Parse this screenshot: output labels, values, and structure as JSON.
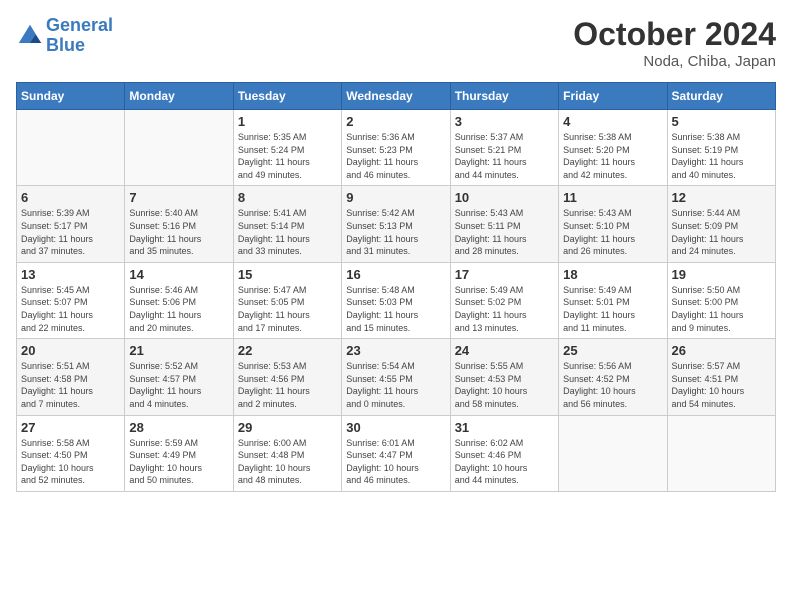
{
  "logo": {
    "line1": "General",
    "line2": "Blue"
  },
  "title": "October 2024",
  "subtitle": "Noda, Chiba, Japan",
  "days_of_week": [
    "Sunday",
    "Monday",
    "Tuesday",
    "Wednesday",
    "Thursday",
    "Friday",
    "Saturday"
  ],
  "weeks": [
    [
      {
        "day": "",
        "info": ""
      },
      {
        "day": "",
        "info": ""
      },
      {
        "day": "1",
        "info": "Sunrise: 5:35 AM\nSunset: 5:24 PM\nDaylight: 11 hours\nand 49 minutes."
      },
      {
        "day": "2",
        "info": "Sunrise: 5:36 AM\nSunset: 5:23 PM\nDaylight: 11 hours\nand 46 minutes."
      },
      {
        "day": "3",
        "info": "Sunrise: 5:37 AM\nSunset: 5:21 PM\nDaylight: 11 hours\nand 44 minutes."
      },
      {
        "day": "4",
        "info": "Sunrise: 5:38 AM\nSunset: 5:20 PM\nDaylight: 11 hours\nand 42 minutes."
      },
      {
        "day": "5",
        "info": "Sunrise: 5:38 AM\nSunset: 5:19 PM\nDaylight: 11 hours\nand 40 minutes."
      }
    ],
    [
      {
        "day": "6",
        "info": "Sunrise: 5:39 AM\nSunset: 5:17 PM\nDaylight: 11 hours\nand 37 minutes."
      },
      {
        "day": "7",
        "info": "Sunrise: 5:40 AM\nSunset: 5:16 PM\nDaylight: 11 hours\nand 35 minutes."
      },
      {
        "day": "8",
        "info": "Sunrise: 5:41 AM\nSunset: 5:14 PM\nDaylight: 11 hours\nand 33 minutes."
      },
      {
        "day": "9",
        "info": "Sunrise: 5:42 AM\nSunset: 5:13 PM\nDaylight: 11 hours\nand 31 minutes."
      },
      {
        "day": "10",
        "info": "Sunrise: 5:43 AM\nSunset: 5:11 PM\nDaylight: 11 hours\nand 28 minutes."
      },
      {
        "day": "11",
        "info": "Sunrise: 5:43 AM\nSunset: 5:10 PM\nDaylight: 11 hours\nand 26 minutes."
      },
      {
        "day": "12",
        "info": "Sunrise: 5:44 AM\nSunset: 5:09 PM\nDaylight: 11 hours\nand 24 minutes."
      }
    ],
    [
      {
        "day": "13",
        "info": "Sunrise: 5:45 AM\nSunset: 5:07 PM\nDaylight: 11 hours\nand 22 minutes."
      },
      {
        "day": "14",
        "info": "Sunrise: 5:46 AM\nSunset: 5:06 PM\nDaylight: 11 hours\nand 20 minutes."
      },
      {
        "day": "15",
        "info": "Sunrise: 5:47 AM\nSunset: 5:05 PM\nDaylight: 11 hours\nand 17 minutes."
      },
      {
        "day": "16",
        "info": "Sunrise: 5:48 AM\nSunset: 5:03 PM\nDaylight: 11 hours\nand 15 minutes."
      },
      {
        "day": "17",
        "info": "Sunrise: 5:49 AM\nSunset: 5:02 PM\nDaylight: 11 hours\nand 13 minutes."
      },
      {
        "day": "18",
        "info": "Sunrise: 5:49 AM\nSunset: 5:01 PM\nDaylight: 11 hours\nand 11 minutes."
      },
      {
        "day": "19",
        "info": "Sunrise: 5:50 AM\nSunset: 5:00 PM\nDaylight: 11 hours\nand 9 minutes."
      }
    ],
    [
      {
        "day": "20",
        "info": "Sunrise: 5:51 AM\nSunset: 4:58 PM\nDaylight: 11 hours\nand 7 minutes."
      },
      {
        "day": "21",
        "info": "Sunrise: 5:52 AM\nSunset: 4:57 PM\nDaylight: 11 hours\nand 4 minutes."
      },
      {
        "day": "22",
        "info": "Sunrise: 5:53 AM\nSunset: 4:56 PM\nDaylight: 11 hours\nand 2 minutes."
      },
      {
        "day": "23",
        "info": "Sunrise: 5:54 AM\nSunset: 4:55 PM\nDaylight: 11 hours\nand 0 minutes."
      },
      {
        "day": "24",
        "info": "Sunrise: 5:55 AM\nSunset: 4:53 PM\nDaylight: 10 hours\nand 58 minutes."
      },
      {
        "day": "25",
        "info": "Sunrise: 5:56 AM\nSunset: 4:52 PM\nDaylight: 10 hours\nand 56 minutes."
      },
      {
        "day": "26",
        "info": "Sunrise: 5:57 AM\nSunset: 4:51 PM\nDaylight: 10 hours\nand 54 minutes."
      }
    ],
    [
      {
        "day": "27",
        "info": "Sunrise: 5:58 AM\nSunset: 4:50 PM\nDaylight: 10 hours\nand 52 minutes."
      },
      {
        "day": "28",
        "info": "Sunrise: 5:59 AM\nSunset: 4:49 PM\nDaylight: 10 hours\nand 50 minutes."
      },
      {
        "day": "29",
        "info": "Sunrise: 6:00 AM\nSunset: 4:48 PM\nDaylight: 10 hours\nand 48 minutes."
      },
      {
        "day": "30",
        "info": "Sunrise: 6:01 AM\nSunset: 4:47 PM\nDaylight: 10 hours\nand 46 minutes."
      },
      {
        "day": "31",
        "info": "Sunrise: 6:02 AM\nSunset: 4:46 PM\nDaylight: 10 hours\nand 44 minutes."
      },
      {
        "day": "",
        "info": ""
      },
      {
        "day": "",
        "info": ""
      }
    ]
  ]
}
